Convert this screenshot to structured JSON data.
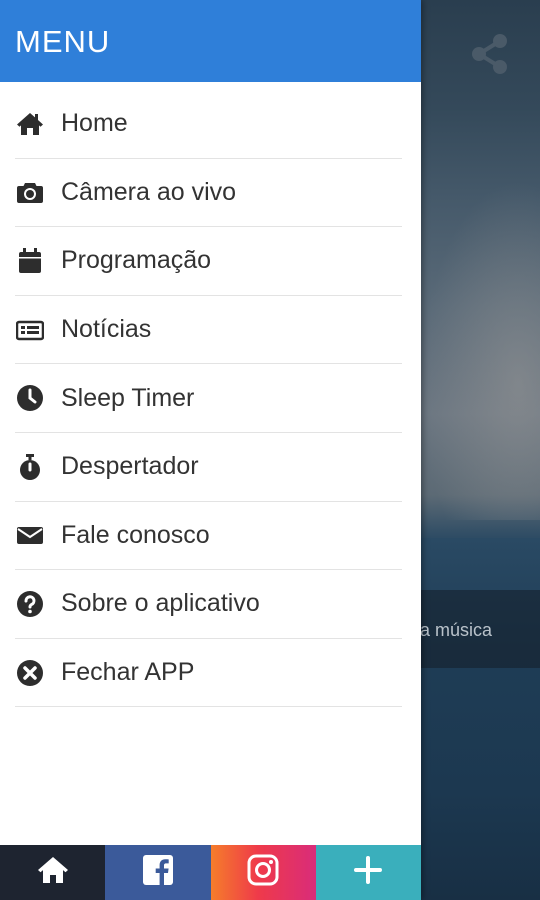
{
  "background": {
    "band_text": "a música",
    "share_icon": "share-icon"
  },
  "drawer": {
    "title": "MENU",
    "header_color": "#2f7fd9",
    "items": [
      {
        "label": "Home",
        "icon": "home-icon"
      },
      {
        "label": "Câmera ao vivo",
        "icon": "camera-icon"
      },
      {
        "label": "Programação",
        "icon": "calendar-icon"
      },
      {
        "label": "Notícias",
        "icon": "newspaper-icon"
      },
      {
        "label": "Sleep Timer",
        "icon": "clock-icon"
      },
      {
        "label": "Despertador",
        "icon": "stopwatch-icon"
      },
      {
        "label": "Fale conosco",
        "icon": "envelope-icon"
      },
      {
        "label": "Sobre o aplicativo",
        "icon": "question-circle-icon"
      },
      {
        "label": "Fechar APP",
        "icon": "close-circle-icon"
      }
    ]
  },
  "bottom_bar": {
    "buttons": [
      {
        "icon": "home-icon",
        "color": "#1e2430"
      },
      {
        "icon": "facebook-icon",
        "color": "#3b5a9a"
      },
      {
        "icon": "instagram-icon",
        "color": "#ef3a4a"
      },
      {
        "icon": "plus-icon",
        "color": "#3aafbc"
      }
    ]
  }
}
